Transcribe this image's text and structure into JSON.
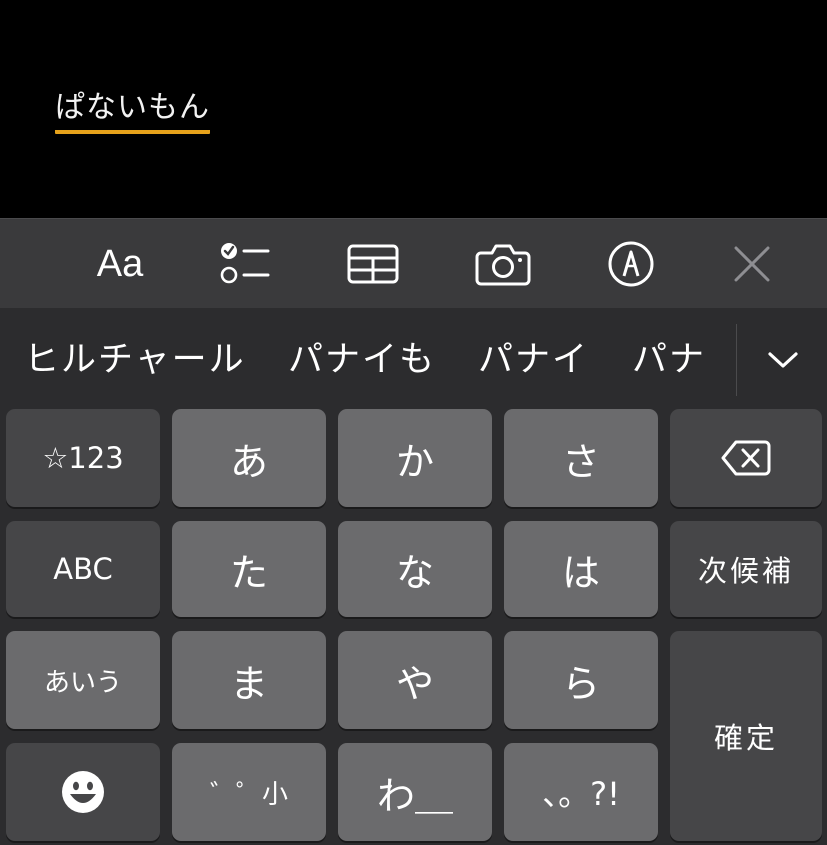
{
  "note": {
    "composing_text": "ぱないもん"
  },
  "toolbar": {
    "format_label": "Aa",
    "items": [
      "format-text",
      "checklist-icon",
      "table-icon",
      "camera-icon",
      "markup-icon",
      "close-icon"
    ]
  },
  "predictions": {
    "candidates": [
      "ヒルチャール",
      "パナイも",
      "パナイ",
      "パナ"
    ],
    "expand_icon": "chevron-down-icon"
  },
  "keyboard": {
    "rows": [
      [
        "☆123",
        "あ",
        "か",
        "さ",
        "delete"
      ],
      [
        "ABC",
        "た",
        "な",
        "は",
        "次候補"
      ],
      [
        "あいう",
        "ま",
        "や",
        "ら",
        "確定"
      ],
      [
        "emoji",
        "゛゜小",
        "わ＿",
        "、。?!"
      ]
    ],
    "symbols_label": "☆123",
    "abc_label": "ABC",
    "kana_label": "あいう",
    "next_candidate_label": "次候補",
    "confirm_label": "確定",
    "k_a": "あ",
    "k_ka": "か",
    "k_sa": "さ",
    "k_ta": "た",
    "k_na": "な",
    "k_ha": "は",
    "k_ma": "ま",
    "k_ya": "や",
    "k_ra": "ら",
    "k_dakuten": "゛゜小",
    "k_wa": "わ＿",
    "k_punct": "、。?!",
    "colors": {
      "light_key": "#6b6b6d",
      "dark_key": "#464648",
      "underline": "#e6a21b"
    }
  }
}
